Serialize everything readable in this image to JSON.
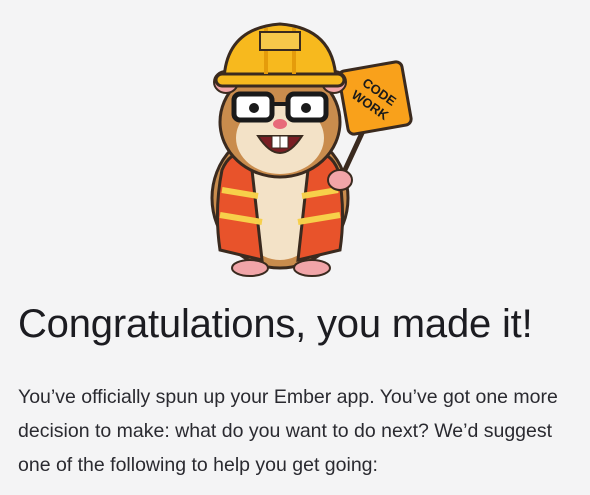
{
  "mascot": {
    "icon": "construction-hamster-illustration",
    "sign_text_line1": "CODE",
    "sign_text_line2": "WORK"
  },
  "welcome": {
    "title": "Congratulations, you made it!",
    "body": "You’ve officially spun up your Ember app. You’ve got one more decision to make: what do you want to do next? We’d suggest one of the following to help you get going:"
  },
  "colors": {
    "background": "#f4f4f5",
    "helmet": "#f7b91e",
    "vest": "#e8532b",
    "sign": "#f9a11b"
  }
}
